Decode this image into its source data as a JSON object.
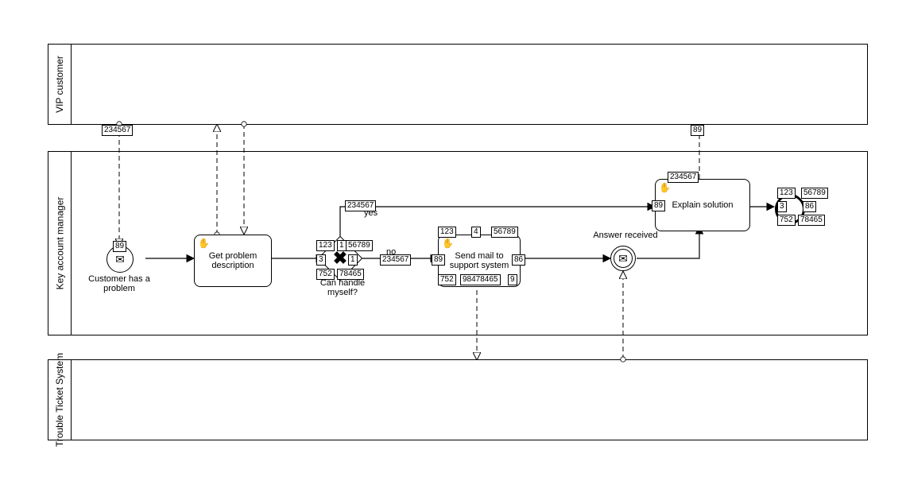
{
  "pools": {
    "vip": "VIP customer",
    "kam": "Key account manager",
    "tts": "Trouble Ticket System"
  },
  "events": {
    "start_label": "Customer has a problem",
    "inter_label": "Answer received"
  },
  "tasks": {
    "get_problem": "Get problem description",
    "send_mail": "Send mail to support system",
    "explain": "Explain solution"
  },
  "gateway": {
    "label": "Can handle myself?",
    "yes": "yes",
    "no": "no"
  },
  "boxlabels": {
    "b234567": "234567",
    "b89": "89",
    "b123": "123",
    "b1": "1",
    "b56789": "56789",
    "b3": "3",
    "b752": "752",
    "b78465": "78465",
    "b4": "4",
    "b86": "86",
    "b98478465": "98478465",
    "b9": "9"
  }
}
